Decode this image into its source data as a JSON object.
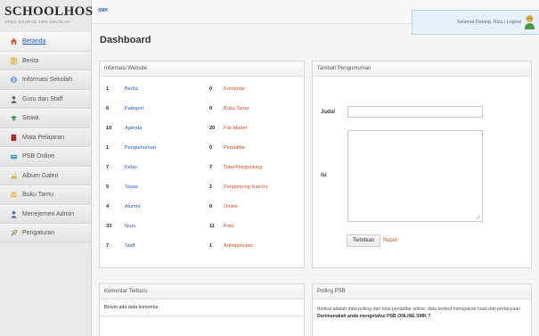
{
  "brand": {
    "title": "SCHOOLHOS",
    "subtitle": "OPEN SOURCE CMS SEKOLAH",
    "tag": "SMK"
  },
  "user": {
    "greeting": "Selamat Datang, Riza | Logout"
  },
  "sidebar": {
    "items": [
      {
        "label": "Beranda",
        "icon": "home-icon"
      },
      {
        "label": "Berita",
        "icon": "news-icon"
      },
      {
        "label": "Informasi Sekolah",
        "icon": "info-icon"
      },
      {
        "label": "Guru dan Staff",
        "icon": "teacher-icon"
      },
      {
        "label": "Siswa",
        "icon": "student-icon"
      },
      {
        "label": "Mata Pelajaran",
        "icon": "book-icon"
      },
      {
        "label": "PSB Online",
        "icon": "registration-icon"
      },
      {
        "label": "Album Galeri",
        "icon": "gallery-icon"
      },
      {
        "label": "Buku Tamu",
        "icon": "guestbook-icon"
      },
      {
        "label": "Menejemen Admin",
        "icon": "admin-icon"
      },
      {
        "label": "Pengaturan",
        "icon": "settings-icon"
      }
    ]
  },
  "page": {
    "title": "Dashboard"
  },
  "info_panel": {
    "title": "Informasi Website",
    "rows": [
      {
        "n1": "1",
        "l1": "Berita",
        "n2": "0",
        "l2": "Komentar"
      },
      {
        "n1": "6",
        "l1": "Kategori",
        "n2": "0",
        "l2": "Buku Tamu"
      },
      {
        "n1": "10",
        "l1": "Agenda",
        "n2": "20",
        "l2": "File Materi"
      },
      {
        "n1": "1",
        "l1": "Pengumuman",
        "n2": "0",
        "l2": "Pendaftar"
      },
      {
        "n1": "7",
        "l1": "Kelas",
        "n2": "7",
        "l2": "Total Pengunjung"
      },
      {
        "n1": "5",
        "l1": "Siswa",
        "n2": "1",
        "l2": "Pengunjung Hari ini"
      },
      {
        "n1": "4",
        "l1": "Alumni",
        "n2": "0",
        "l2": "Online"
      },
      {
        "n1": "33",
        "l1": "Guru",
        "n2": "11",
        "l2": "Foto"
      },
      {
        "n1": "7",
        "l1": "Staff",
        "n2": "1",
        "l2": "Administrator"
      }
    ]
  },
  "announcement_form": {
    "title": "Tambah Pengumuman",
    "title_label": "Judul",
    "title_value": "",
    "body_label": "Isi",
    "body_value": "",
    "publish_label": "Terbitkan",
    "reset_label": "Reset"
  },
  "comments_panel": {
    "title": "Komentar Terbaru",
    "empty_text": "Belum ada data komentar"
  },
  "poll_panel": {
    "title": "Polling PSB",
    "text_start": "Berikut adalah data polling dari total pendaftar online, data berikut merupakan hasil dari pertanyaan ",
    "text_bold": "Darimanakah anda mengetahui PSB ONLINE SMK ?"
  },
  "colors": {
    "link_blue": "#2b5bb0",
    "accent_red": "#d94a24"
  }
}
